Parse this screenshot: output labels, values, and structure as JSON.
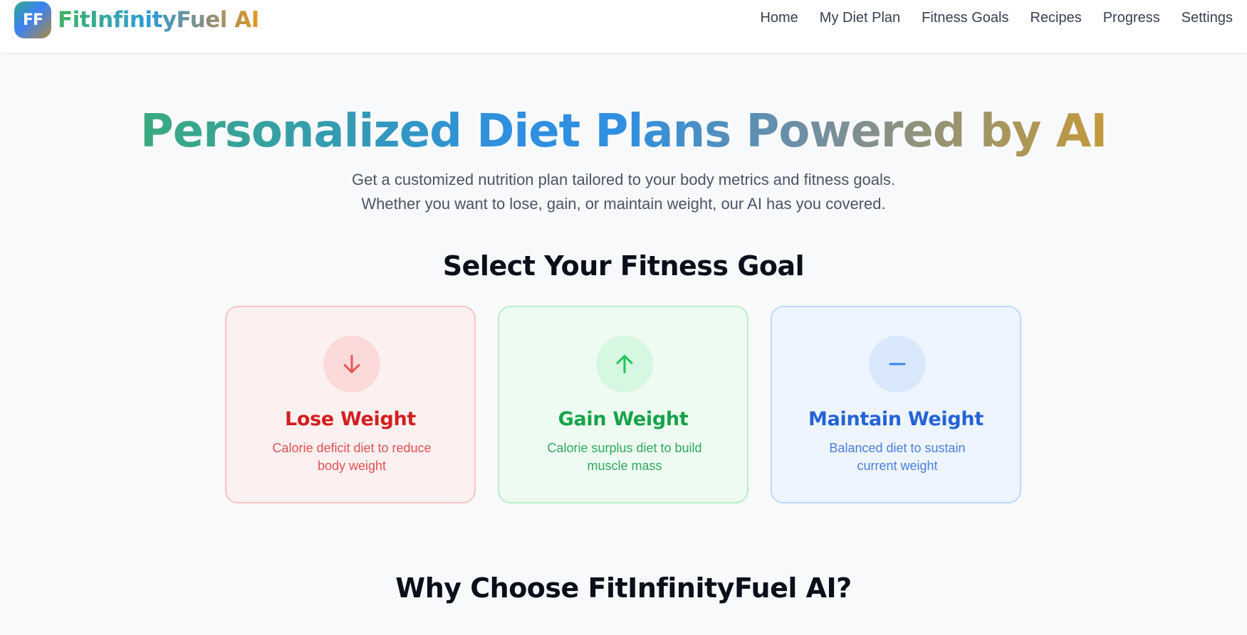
{
  "brand": {
    "badge": "FF",
    "name": "FitInfinityFuel AI"
  },
  "nav": {
    "items": [
      "Home",
      "My Diet Plan",
      "Fitness Goals",
      "Recipes",
      "Progress",
      "Settings"
    ]
  },
  "hero": {
    "title": "Personalized Diet Plans Powered by AI",
    "subtitle_line1": "Get a customized nutrition plan tailored to your body metrics and fitness goals.",
    "subtitle_line2": "Whether you want to lose, gain, or maintain weight, our AI has you covered."
  },
  "goals": {
    "heading": "Select Your Fitness Goal",
    "cards": [
      {
        "title": "Lose Weight",
        "description": "Calorie deficit diet to reduce body weight",
        "icon": "arrow-down-icon",
        "color": "#d21f1f"
      },
      {
        "title": "Gain Weight",
        "description": "Calorie surplus diet to build muscle mass",
        "icon": "arrow-up-icon",
        "color": "#16a34a"
      },
      {
        "title": "Maintain Weight",
        "description": "Balanced diet to sustain current weight",
        "icon": "minus-icon",
        "color": "#2563d6"
      }
    ]
  },
  "why": {
    "heading": "Why Choose FitInfinityFuel AI?"
  }
}
